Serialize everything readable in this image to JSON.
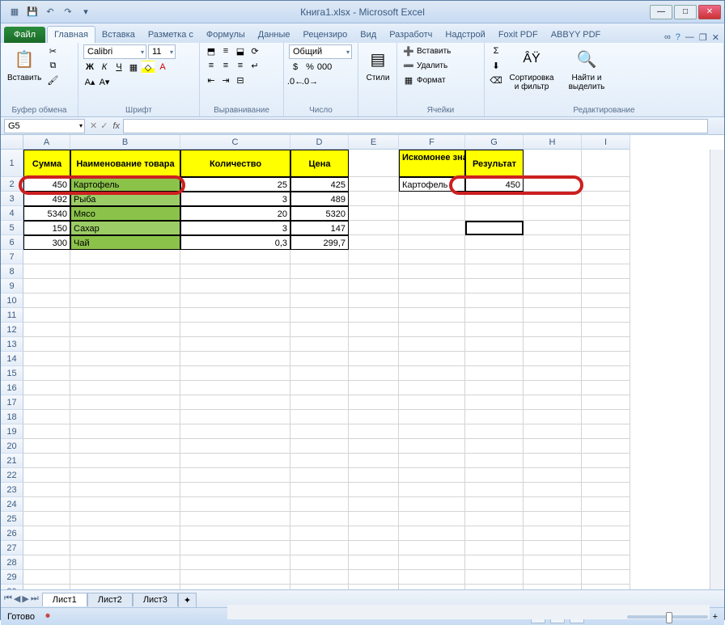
{
  "window": {
    "title": "Книга1.xlsx - Microsoft Excel"
  },
  "tabs": {
    "file": "Файл",
    "items": [
      "Главная",
      "Вставка",
      "Разметка с",
      "Формулы",
      "Данные",
      "Рецензиро",
      "Вид",
      "Разработч",
      "Надстрой",
      "Foxit PDF",
      "ABBYY PDF"
    ],
    "active": 0
  },
  "ribbon": {
    "clipboard": {
      "paste": "Вставить",
      "label": "Буфер обмена"
    },
    "font": {
      "name": "Calibri",
      "size": "11",
      "label": "Шрифт"
    },
    "align": {
      "label": "Выравнивание"
    },
    "number": {
      "format": "Общий",
      "label": "Число"
    },
    "styles": {
      "btn": "Стили",
      "label": ""
    },
    "cells": {
      "insert": "Вставить",
      "delete": "Удалить",
      "format": "Формат",
      "label": "Ячейки"
    },
    "editing": {
      "sort": "Сортировка и фильтр",
      "find": "Найти и выделить",
      "label": "Редактирование"
    }
  },
  "namebox": "G5",
  "cols": {
    "A": 58,
    "B": 136,
    "C": 136,
    "D": 72,
    "E": 62,
    "F": 82,
    "G": 72,
    "H": 72,
    "I": 40
  },
  "headers": {
    "A": "Сумма",
    "B": "Наименование товара",
    "C": "Количество",
    "D": "Цена",
    "F": "Искомонее значение",
    "G": "Результат"
  },
  "rows": [
    {
      "A": "450",
      "B": "Картофель",
      "C": "25",
      "D": "425",
      "F": "Картофель",
      "G": "450"
    },
    {
      "A": "492",
      "B": "Рыба",
      "C": "3",
      "D": "489"
    },
    {
      "A": "5340",
      "B": "Мясо",
      "C": "20",
      "D": "5320"
    },
    {
      "A": "150",
      "B": "Сахар",
      "C": "3",
      "D": "147"
    },
    {
      "A": "300",
      "B": "Чай",
      "C": "0,3",
      "D": "299,7"
    }
  ],
  "sheets": [
    "Лист1",
    "Лист2",
    "Лист3"
  ],
  "status": {
    "ready": "Готово",
    "zoom": "100%"
  }
}
